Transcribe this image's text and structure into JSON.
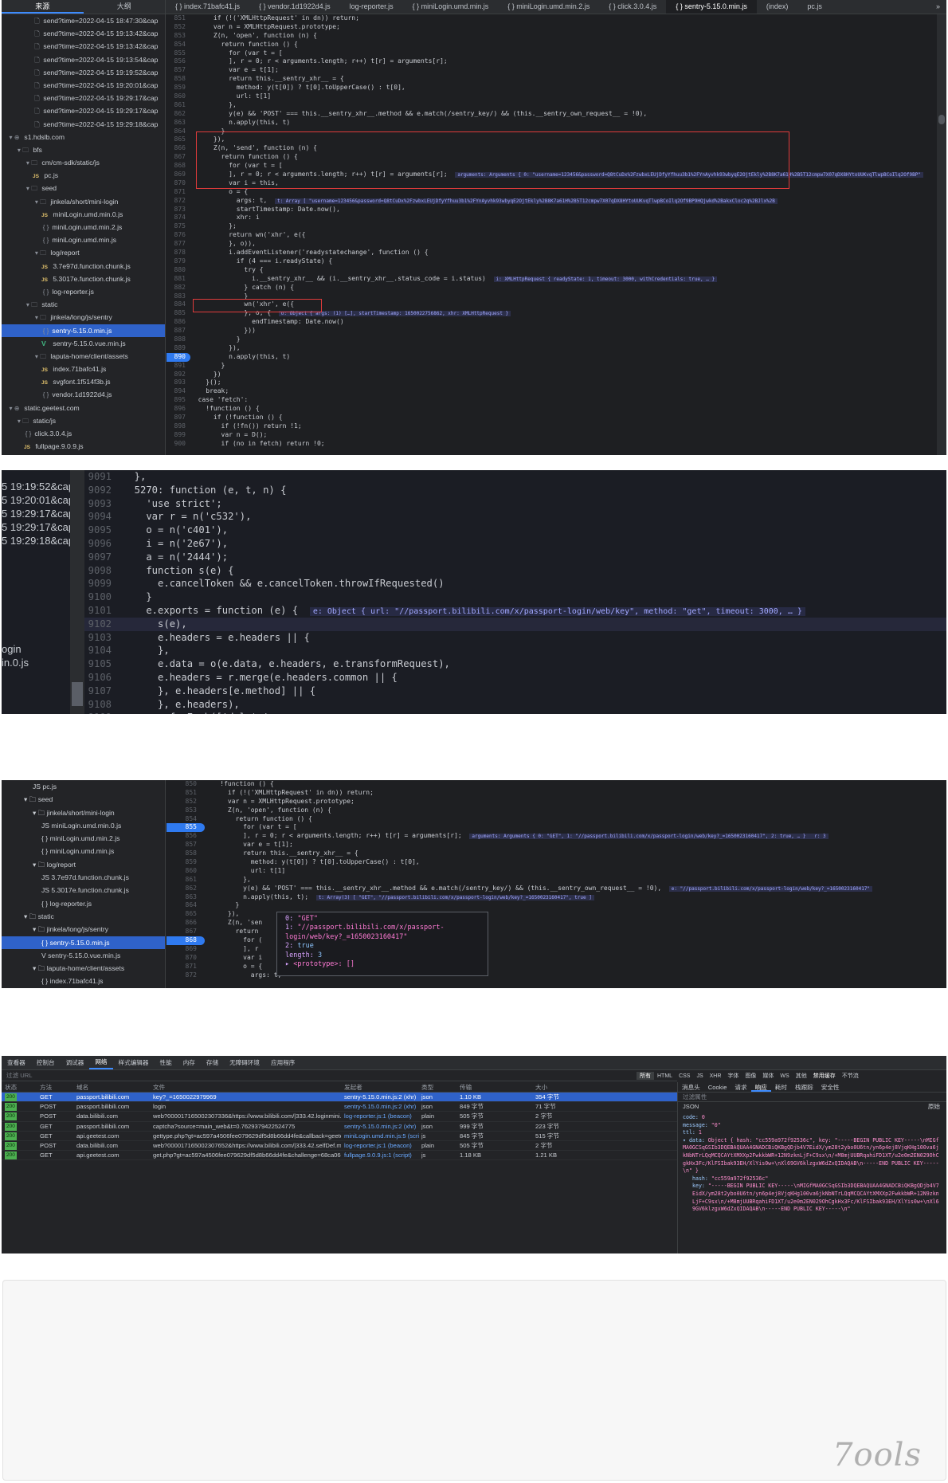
{
  "panel1": {
    "side_tabs": [
      "来源",
      "大纲"
    ],
    "file_tabs": [
      "{ } index.71bafc41.js",
      "{ } vendor.1d1922d4.js",
      "log-reporter.js",
      "{ } miniLogin.umd.min.js",
      "{ } miniLogin.umd.min.2.js",
      "{ } click.3.0.4.js",
      "{ } sentry-5.15.0.min.js",
      "(index)",
      "pc.js"
    ],
    "active_file_tab": 6,
    "overflow_label": "»",
    "tree": [
      {
        "indent": 3,
        "icon": "file",
        "label": "send?time=2022-04-15 18:47:30&cap"
      },
      {
        "indent": 3,
        "icon": "file",
        "label": "send?time=2022-04-15 19:13:42&cap"
      },
      {
        "indent": 3,
        "icon": "file",
        "label": "send?time=2022-04-15 19:13:42&cap"
      },
      {
        "indent": 3,
        "icon": "file",
        "label": "send?time=2022-04-15 19:13:54&cap"
      },
      {
        "indent": 3,
        "icon": "file",
        "label": "send?time=2022-04-15 19:19:52&cap"
      },
      {
        "indent": 3,
        "icon": "file",
        "label": "send?time=2022-04-15 19:20:01&cap"
      },
      {
        "indent": 3,
        "icon": "file",
        "label": "send?time=2022-04-15 19:29:17&cap"
      },
      {
        "indent": 3,
        "icon": "file",
        "label": "send?time=2022-04-15 19:29:17&cap"
      },
      {
        "indent": 3,
        "icon": "file",
        "label": "send?time=2022-04-15 19:29:18&cap"
      },
      {
        "indent": 0,
        "icon": "globe",
        "label": "s1.hdslb.com"
      },
      {
        "indent": 1,
        "icon": "folder",
        "label": "bfs"
      },
      {
        "indent": 2,
        "icon": "folder",
        "label": "cm/cm-sdk/static/js"
      },
      {
        "indent": 3,
        "icon": "js",
        "label": "pc.js"
      },
      {
        "indent": 2,
        "icon": "folder",
        "label": "seed"
      },
      {
        "indent": 3,
        "icon": "folder",
        "label": "jinkela/short/mini-login"
      },
      {
        "indent": 4,
        "icon": "js",
        "label": "miniLogin.umd.min.0.js"
      },
      {
        "indent": 4,
        "icon": "braces",
        "label": "miniLogin.umd.min.2.js"
      },
      {
        "indent": 4,
        "icon": "braces",
        "label": "miniLogin.umd.min.js"
      },
      {
        "indent": 3,
        "icon": "folder",
        "label": "log/report"
      },
      {
        "indent": 4,
        "icon": "js",
        "label": "3.7e97d.function.chunk.js"
      },
      {
        "indent": 4,
        "icon": "js",
        "label": "5.3017e.function.chunk.js"
      },
      {
        "indent": 4,
        "icon": "braces",
        "label": "log-reporter.js"
      },
      {
        "indent": 2,
        "icon": "folder",
        "label": "static"
      },
      {
        "indent": 3,
        "icon": "folder",
        "label": "jinkela/long/js/sentry"
      },
      {
        "indent": 4,
        "icon": "braces",
        "label": "sentry-5.15.0.min.js",
        "selected": true
      },
      {
        "indent": 4,
        "icon": "vue",
        "label": "sentry-5.15.0.vue.min.js"
      },
      {
        "indent": 3,
        "icon": "folder",
        "label": "laputa-home/client/assets"
      },
      {
        "indent": 4,
        "icon": "js",
        "label": "index.71bafc41.js"
      },
      {
        "indent": 4,
        "icon": "js",
        "label": "svgfont.1f514f3b.js"
      },
      {
        "indent": 4,
        "icon": "braces",
        "label": "vendor.1d1922d4.js"
      },
      {
        "indent": 0,
        "icon": "globe",
        "label": "static.geetest.com"
      },
      {
        "indent": 1,
        "icon": "folder",
        "label": "static/js"
      },
      {
        "indent": 2,
        "icon": "braces",
        "label": "click.3.0.4.js"
      },
      {
        "indent": 2,
        "icon": "js",
        "label": "fullpage.9.0.9.js"
      }
    ],
    "code": [
      {
        "n": "851",
        "t": "      if (!('XMLHttpRequest' in dn)) return;"
      },
      {
        "n": "852",
        "t": "      var n = XMLHttpRequest.prototype;"
      },
      {
        "n": "853",
        "t": "      Z(n, 'open', function (n) {"
      },
      {
        "n": "854",
        "t": "        return function () {"
      },
      {
        "n": "855",
        "t": "          for (var t = ["
      },
      {
        "n": "856",
        "t": "          ], r = 0; r < arguments.length; r++) t[r] = arguments[r];"
      },
      {
        "n": "857",
        "t": "          var e = t[1];"
      },
      {
        "n": "858",
        "t": "          return this.__sentry_xhr__ = {"
      },
      {
        "n": "859",
        "t": "            method: y(t[0]) ? t[0].toUpperCase() : t[0],"
      },
      {
        "n": "860",
        "t": "            url: t[1]"
      },
      {
        "n": "861",
        "t": "          },"
      },
      {
        "n": "862",
        "t": "          y(e) && 'POST' === this.__sentry_xhr__.method && e.match(/sentry_key/) && (this.__sentry_own_request__ = !0),"
      },
      {
        "n": "863",
        "t": "          n.apply(this, t)"
      },
      {
        "n": "864",
        "t": "        }"
      },
      {
        "n": "865",
        "t": "      }),"
      },
      {
        "n": "866",
        "t": "      Z(n, 'send', function (n) {"
      },
      {
        "n": "867",
        "t": "        return function () {"
      },
      {
        "n": "868",
        "t": "          for (var t = ["
      },
      {
        "n": "869",
        "t": "          ], r = 0; r < arguments.length; r++) t[r] = arguments[r];",
        "inline": "arguments: Arguments { 0: \"username=123456&password=Q8tCuDx%2FzwbxLEUjDfyYfhuu3b1%2FYnAyvhk93wbyqE2OjtEkly%2B8K7a61H%2B5T12cmpw7X07qDX8HYtoUUKvqTlwpBCoIlq2Of9BP\""
      },
      {
        "n": "870",
        "t": "          var i = this,"
      },
      {
        "n": "871",
        "t": "          o = {"
      },
      {
        "n": "872",
        "t": "            args: t,",
        "inline": "t: Array [ \"username=123456&password=Q8tCuDx%2FzwbxLEUjDfyYfhuu3b1%2FYnAyvhk93wbyqE2OjtEkly%2B8K7a61H%2B5T12cmpw7X07qDX8HYtoUUKvqTlwpBCoIlq2Of9BP9HQjwkd%2BakxCloc2q%2BJlx%2B"
      },
      {
        "n": "873",
        "t": "            startTimestamp: Date.now(),"
      },
      {
        "n": "874",
        "t": "            xhr: i"
      },
      {
        "n": "875",
        "t": "          };"
      },
      {
        "n": "876",
        "t": "          return wn('xhr', e({"
      },
      {
        "n": "877",
        "t": "          }, o)),"
      },
      {
        "n": "878",
        "t": "          i.addEventListener('readystatechange', function () {"
      },
      {
        "n": "879",
        "t": "            if (4 === i.readyState) {"
      },
      {
        "n": "880",
        "t": "              try {"
      },
      {
        "n": "881",
        "t": "                i.__sentry_xhr__ && (i.__sentry_xhr__.status_code = i.status)",
        "inline": "i: XMLHttpRequest { readyState: 1, timeout: 3000, withCredentials: true, … }"
      },
      {
        "n": "882",
        "t": "              } catch (n) {"
      },
      {
        "n": "883",
        "t": "              }"
      },
      {
        "n": "884",
        "t": "              wn('xhr', e({"
      },
      {
        "n": "885",
        "t": "              }, o, {",
        "inline": "o: Object { args: (1) […], startTimestamp: 1650022756862, xhr: XMLHttpRequest }"
      },
      {
        "n": "886",
        "t": "                endTimestamp: Date.now()"
      },
      {
        "n": "887",
        "t": "              }))"
      },
      {
        "n": "888",
        "t": "            }"
      },
      {
        "n": "889",
        "t": "          }),"
      },
      {
        "n": "890",
        "t": "          n.apply(this, t)",
        "bp": true
      },
      {
        "n": "891",
        "t": "        }"
      },
      {
        "n": "892",
        "t": "      })"
      },
      {
        "n": "893",
        "t": "    }();"
      },
      {
        "n": "894",
        "t": "    break;"
      },
      {
        "n": "895",
        "t": "  case 'fetch':"
      },
      {
        "n": "896",
        "t": "    !function () {"
      },
      {
        "n": "897",
        "t": "      if (!function () {"
      },
      {
        "n": "898",
        "t": "        if (!fn()) return !1;"
      },
      {
        "n": "899",
        "t": "        var n = D();"
      },
      {
        "n": "900",
        "t": "        if (no in fetch) return !0;"
      }
    ]
  },
  "panel2": {
    "left_items": [
      "5 19:19:52&cap",
      "5 19:20:01&cap",
      "5 19:29:17&cap",
      "5 19:29:17&cap",
      "5 19:29:18&cap",
      "ogin",
      "in.0.js"
    ],
    "code": [
      {
        "n": "9091",
        "t": "  },"
      },
      {
        "n": "9092",
        "t": "  5270: function (e, t, n) {"
      },
      {
        "n": "9093",
        "t": "    'use strict';"
      },
      {
        "n": "9094",
        "t": "    var r = n('c532'),"
      },
      {
        "n": "9095",
        "t": "    o = n('c401'),"
      },
      {
        "n": "9096",
        "t": "    i = n('2e67'),"
      },
      {
        "n": "9097",
        "t": "    a = n('2444');"
      },
      {
        "n": "9098",
        "t": "    function s(e) {"
      },
      {
        "n": "9099",
        "t": "      e.cancelToken && e.cancelToken.throwIfRequested()"
      },
      {
        "n": "9100",
        "t": "    }"
      },
      {
        "n": "9101",
        "t": "    e.exports = function (e) {",
        "inline": "e: Object { url: \"//passport.bilibili.com/x/passport-login/web/key\", method: \"get\", timeout: 3000, … }"
      },
      {
        "n": "9102",
        "t": "      s(e),",
        "hl": true
      },
      {
        "n": "9103",
        "t": "      e.headers = e.headers || {"
      },
      {
        "n": "9104",
        "t": "      },"
      },
      {
        "n": "9105",
        "t": "      e.data = o(e.data, e.headers, e.transformRequest),"
      },
      {
        "n": "9106",
        "t": "      e.headers = r.merge(e.headers.common || {"
      },
      {
        "n": "9107",
        "t": "      }, e.headers[e.method] || {"
      },
      {
        "n": "9108",
        "t": "      }, e.headers),"
      },
      {
        "n": "9109",
        "t": "      r.forEach(['delete',"
      }
    ]
  },
  "panel3": {
    "tree": [
      {
        "indent": 3,
        "icon": "js",
        "label": "pc.js"
      },
      {
        "indent": 2,
        "icon": "folder",
        "label": "seed"
      },
      {
        "indent": 3,
        "icon": "folder",
        "label": "jinkela/short/mini-login"
      },
      {
        "indent": 4,
        "icon": "js",
        "label": "miniLogin.umd.min.0.js"
      },
      {
        "indent": 4,
        "icon": "braces",
        "label": "miniLogin.umd.min.2.js"
      },
      {
        "indent": 4,
        "icon": "braces",
        "label": "miniLogin.umd.min.js"
      },
      {
        "indent": 3,
        "icon": "folder",
        "label": "log/report"
      },
      {
        "indent": 4,
        "icon": "js",
        "label": "3.7e97d.function.chunk.js"
      },
      {
        "indent": 4,
        "icon": "js",
        "label": "5.3017e.function.chunk.js"
      },
      {
        "indent": 4,
        "icon": "braces",
        "label": "log-reporter.js"
      },
      {
        "indent": 2,
        "icon": "folder",
        "label": "static"
      },
      {
        "indent": 3,
        "icon": "folder",
        "label": "jinkela/long/js/sentry"
      },
      {
        "indent": 4,
        "icon": "braces",
        "label": "sentry-5.15.0.min.js",
        "selected": true
      },
      {
        "indent": 4,
        "icon": "vue",
        "label": "sentry-5.15.0.vue.min.js"
      },
      {
        "indent": 3,
        "icon": "folder",
        "label": "laputa-home/client/assets"
      },
      {
        "indent": 4,
        "icon": "braces",
        "label": "index.71bafc41.js"
      }
    ],
    "code": [
      {
        "n": "850",
        "t": "    !function () {"
      },
      {
        "n": "851",
        "t": "      if (!('XMLHttpRequest' in dn)) return;"
      },
      {
        "n": "852",
        "t": "      var n = XMLHttpRequest.prototype;"
      },
      {
        "n": "853",
        "t": "      Z(n, 'open', function (n) {"
      },
      {
        "n": "854",
        "t": "        return function () {"
      },
      {
        "n": "855",
        "t": "          for (var t = [",
        "bp": true
      },
      {
        "n": "856",
        "t": "          ], r = 0; r < arguments.length; r++) t[r] = arguments[r];",
        "inline": "arguments: Arguments { 0: \"GET\", 1: \"//passport.bilibili.com/x/passport-login/web/key?_=1650023160417\", 2: true, … }   r: 3"
      },
      {
        "n": "857",
        "t": "          var e = t[1];"
      },
      {
        "n": "858",
        "t": "          return this.__sentry_xhr__ = {"
      },
      {
        "n": "859",
        "t": "            method: y(t[0]) ? t[0].toUpperCase() : t[0],"
      },
      {
        "n": "860",
        "t": "            url: t[1]"
      },
      {
        "n": "861",
        "t": "          },"
      },
      {
        "n": "862",
        "t": "          y(e) && 'POST' === this.__sentry_xhr__.method && e.match(/sentry_key/) && (this.__sentry_own_request__ = !0),",
        "inline": "e: \"//passport.bilibili.com/x/passport-login/web/key?_=1650023160417\""
      },
      {
        "n": "863",
        "t": "          n.apply(this, t);",
        "inline": "t: Array(3) [ \"GET\", \"//passport.bilibili.com/x/passport-login/web/key?_=1650023160417\", true ]"
      },
      {
        "n": "864",
        "t": "        }"
      },
      {
        "n": "865",
        "t": "      }),"
      },
      {
        "n": "866",
        "t": "      Z(n, 'sen"
      },
      {
        "n": "867",
        "t": "        return"
      },
      {
        "n": "868",
        "t": "          for (",
        "bp": true
      },
      {
        "n": "869",
        "t": "          ], r"
      },
      {
        "n": "870",
        "t": "          var i"
      },
      {
        "n": "871",
        "t": "          o = {"
      },
      {
        "n": "872",
        "t": "            args: t,"
      }
    ],
    "popup": [
      {
        "k": "0:",
        "v": "\"GET\""
      },
      {
        "k": "1:",
        "v": "\"//passport.bilibili.com/x/passport-login/web/key?_=1650023160417\""
      },
      {
        "k": "2:",
        "v": "true"
      },
      {
        "k": "length:",
        "v": "3"
      },
      {
        "k": "▸",
        "v": "<prototype>: []"
      }
    ]
  },
  "panel4": {
    "tools": [
      "查看器",
      "控制台",
      "调试器",
      "网络",
      "样式编辑器",
      "性能",
      "内存",
      "存储",
      "无障碍环境",
      "应用程序"
    ],
    "active_tool": 3,
    "filter_placeholder": "过滤 URL",
    "type_filters": [
      "所有",
      "HTML",
      "CSS",
      "JS",
      "XHR",
      "字体",
      "图像",
      "媒体",
      "WS",
      "其他"
    ],
    "cache_label": "禁用缓存",
    "throttle_label": "不节流",
    "headers": [
      "状态",
      "方法",
      "域名",
      "文件",
      "发起者",
      "类型",
      "传输",
      "大小"
    ],
    "rows": [
      {
        "status": "200",
        "method": "GET",
        "domain": "passport.bilibili.com",
        "file": "key?_=1650022979969",
        "initiator": "sentry-5.15.0.min.js:2 (xhr)",
        "type": "json",
        "transfer": "1.10 KB",
        "size": "354 字节",
        "selected": true
      },
      {
        "status": "200",
        "method": "POST",
        "domain": "passport.bilibili.com",
        "file": "login",
        "initiator": "sentry-5.15.0.min.js:2 (xhr)",
        "type": "json",
        "transfer": "849 字节",
        "size": "71 字节"
      },
      {
        "status": "200",
        "method": "POST",
        "domain": "data.bilibili.com",
        "file": "web?000017165002307336&https://www.bilibili.com/|333.42.loginmini.login|1650023(",
        "initiator": "log-reporter.js:1 (beacon)",
        "type": "plain",
        "transfer": "505 字节",
        "size": "2 字节"
      },
      {
        "status": "200",
        "method": "GET",
        "domain": "passport.bilibili.com",
        "file": "captcha?source=main_web&t=0.7629379422524775",
        "initiator": "sentry-5.15.0.min.js:2 (xhr)",
        "type": "json",
        "transfer": "999 字节",
        "size": "223 字节"
      },
      {
        "status": "200",
        "method": "GET",
        "domain": "api.geetest.com",
        "file": "gettype.php?gt=ac597a4506fee079629df5d8b66dd4fe&callback=geetest_165002308(",
        "initiator": "miniLogin.umd.min.js:5 (script)",
        "type": "js",
        "transfer": "845 字节",
        "size": "515 字节"
      },
      {
        "status": "200",
        "method": "POST",
        "domain": "data.bilibili.com",
        "file": "web?000017165002307652&https://www.bilibili.com/|333.42.selfDef.miniloginmini_get",
        "initiator": "log-reporter.js:1 (beacon)",
        "type": "plain",
        "transfer": "505 字节",
        "size": "2 字节"
      },
      {
        "status": "200",
        "method": "GET",
        "domain": "api.geetest.com",
        "file": "get.php?gt=ac597a4506fee079629df5d8b66dd4fe&challenge=68ca060b62260a19dd(",
        "initiator": "fullpage.9.0.9.js:1 (script)",
        "type": "js",
        "transfer": "1.18 KB",
        "size": "1.21 KB"
      }
    ],
    "resp_tabs": [
      "消息头",
      "Cookie",
      "请求",
      "响应",
      "耗时",
      "栈跟踪",
      "安全性"
    ],
    "active_resp_tab": 3,
    "resp_filter": "过滤属性",
    "resp_json_label": "JSON",
    "raw_label": "原始",
    "resp_lines": [
      {
        "k": "code:",
        "v": "0"
      },
      {
        "k": "message:",
        "v": "\"0\""
      },
      {
        "k": "ttl:",
        "v": "1"
      },
      {
        "k": "▾ data:",
        "v": "Object { hash: \"cc559a972f92536c\", key: \"-----BEGIN PUBLIC KEY-----\\nMIGfMA0GCSqGSIb3DQEBAQUAA4GNADCBiQKBgQDjb4V7EidX/ym28t2ybo0U6tn/yn6p4ej8VjqKHg100va6jkNbNTrLQqMCQCAYtXMXXp2FwkkbWR+12N9zknLjF+C9sx\\n/+M8mjUUBRqahiFD1XT/u2e0m2EN029OhCgkHx3Fc/KlFSIbak93EH/XlYis0w+\\nXl69GV6klzgxW6dZxQIDAQAB\\n-----END PUBLIC KEY-----\\n\" }"
      },
      {
        "k": "hash:",
        "v": "\"cc559a972f92536c\""
      },
      {
        "k": "key:",
        "v": "\"-----BEGIN PUBLIC KEY-----\\nMIGfMA0GCSqGSIb3DQEBAQUAA4GNADCBiQKBgQDjb4V7EidX/ym28t2ybo0U6tn/yn6p4ej8VjqKHg100va6jkNbNTrLQqMCQCAYtXMXXp2FwkkbWR+12N9zknLjF+C9sx\\n/+M8mjUUBRqahiFD1XT/u2e0m2EN029OhCgkHx3Fc/KlFSIbak93EH/XlYis0w+\\nXl69GV6klzgxW6dZxQIDAQAB\\n-----END PUBLIC KEY-----\\n\""
      }
    ]
  },
  "panel5": {
    "watermark": "7ools"
  }
}
